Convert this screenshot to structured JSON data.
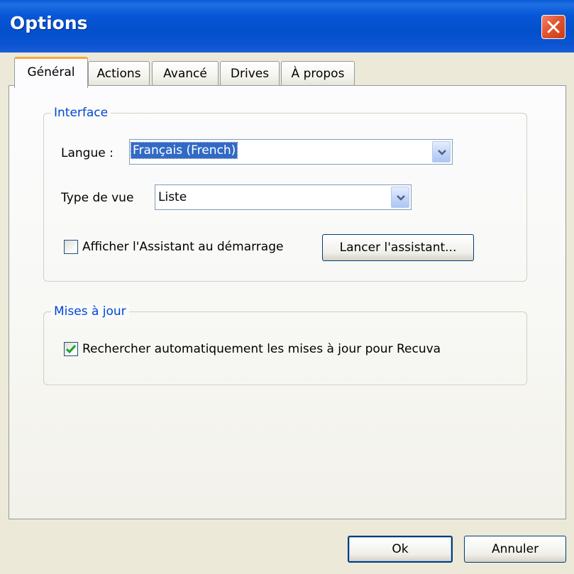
{
  "window": {
    "title": "Options",
    "close_icon": "close-icon"
  },
  "tabs": [
    {
      "label": "Général",
      "active": true
    },
    {
      "label": "Actions",
      "active": false
    },
    {
      "label": "Avancé",
      "active": false
    },
    {
      "label": "Drives",
      "active": false
    },
    {
      "label": "À propos",
      "active": false
    }
  ],
  "interface": {
    "legend": "Interface",
    "language_label": "Langue :",
    "language_value": "Français (French)",
    "view_type_label": "Type de vue",
    "view_type_value": "Liste",
    "wizard_checkbox_label": "Afficher l'Assistant au démarrage",
    "wizard_checkbox_checked": false,
    "launch_wizard_button": "Lancer l'assistant..."
  },
  "updates": {
    "legend": "Mises à jour",
    "auto_check_label": "Rechercher automatiquement les mises à jour pour Recuva",
    "auto_check_checked": true
  },
  "footer": {
    "ok_label": "Ok",
    "cancel_label": "Annuler"
  },
  "colors": {
    "titlebar": "#0656d6",
    "group_legend": "#0046d5",
    "active_tab_accent": "#f8a838",
    "selection": "#316ac5",
    "close_button": "#e2552f"
  }
}
